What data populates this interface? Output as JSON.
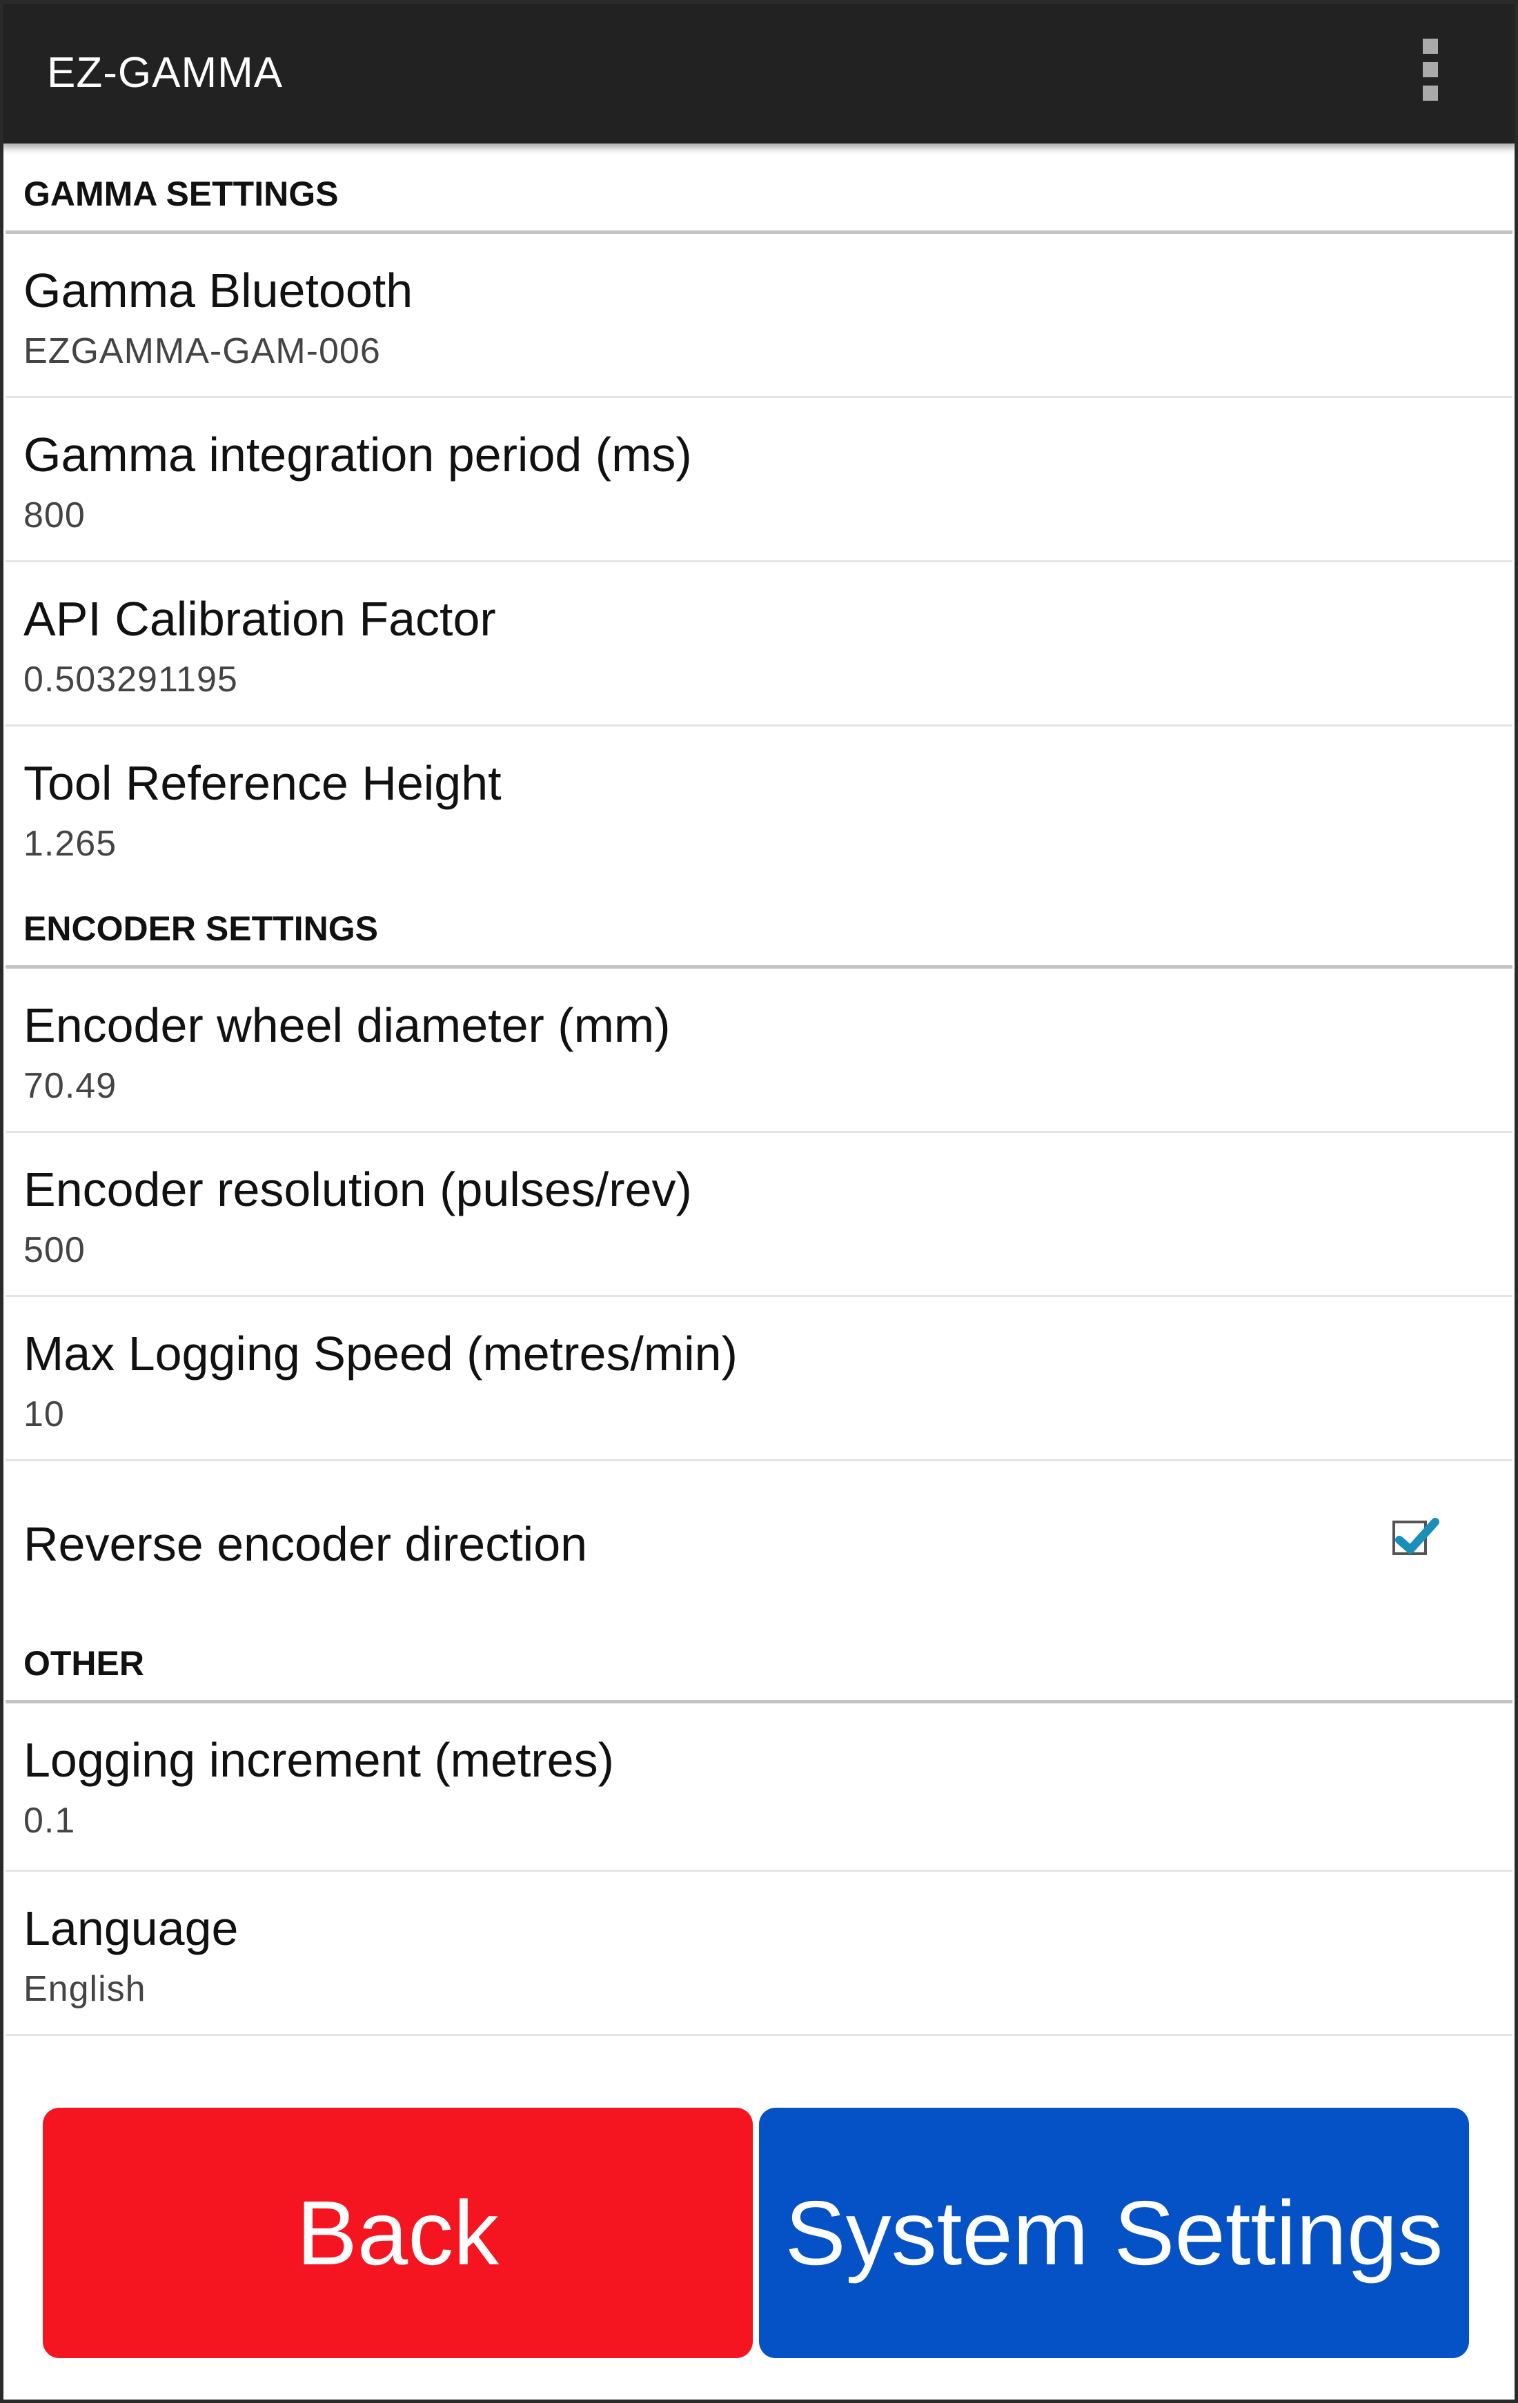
{
  "app": {
    "title": "EZ-GAMMA",
    "menu_icon": "overflow-menu-icon"
  },
  "sections": [
    {
      "header": "GAMMA SETTINGS",
      "items": [
        {
          "title": "Gamma Bluetooth",
          "value": "EZGAMMA-GAM-006"
        },
        {
          "title": "Gamma integration period (ms)",
          "value": "800"
        },
        {
          "title": "API Calibration Factor",
          "value": "0.503291195"
        },
        {
          "title": "Tool Reference Height",
          "value": "1.265"
        }
      ]
    },
    {
      "header": "ENCODER SETTINGS",
      "items": [
        {
          "title": "Encoder wheel diameter (mm)",
          "value": "70.49"
        },
        {
          "title": "Encoder resolution (pulses/rev)",
          "value": "500"
        },
        {
          "title": "Max Logging Speed (metres/min)",
          "value": "10"
        },
        {
          "title": "Reverse encoder direction",
          "checked": true
        }
      ]
    },
    {
      "header": "OTHER",
      "items": [
        {
          "title": "Logging increment (metres)",
          "value": "0.1"
        },
        {
          "title": "Language",
          "value": "English"
        }
      ]
    }
  ],
  "buttons": {
    "back": "Back",
    "system_settings": "System Settings"
  },
  "colors": {
    "back": "#f41520",
    "system_settings": "#0552c6",
    "appbar": "#222222",
    "check": "#1a8fb8"
  }
}
